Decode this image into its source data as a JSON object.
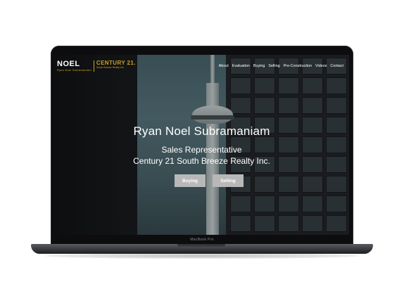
{
  "device": {
    "model_label": "MacBook Pro"
  },
  "logo": {
    "name": "NOEL",
    "name_sub": "Ryan Noel Subramaniam",
    "brokerage": "CENTURY 21.",
    "brokerage_sub": "South Breeze Realty Inc."
  },
  "nav": {
    "items": [
      "About",
      "Evaluation",
      "Buying",
      "Selling",
      "Pre-Construction",
      "Videos",
      "Contact"
    ]
  },
  "hero": {
    "title": "Ryan Noel Subramaniam",
    "subtitle_line1": "Sales Representative",
    "subtitle_line2": "Century 21 South Breeze Realty Inc.",
    "buttons": {
      "buying": "Buying",
      "selling": "Selling"
    }
  },
  "colors": {
    "brand_gold": "#c9a227",
    "button_bg": "#b8b8b8",
    "text": "#ffffff"
  }
}
